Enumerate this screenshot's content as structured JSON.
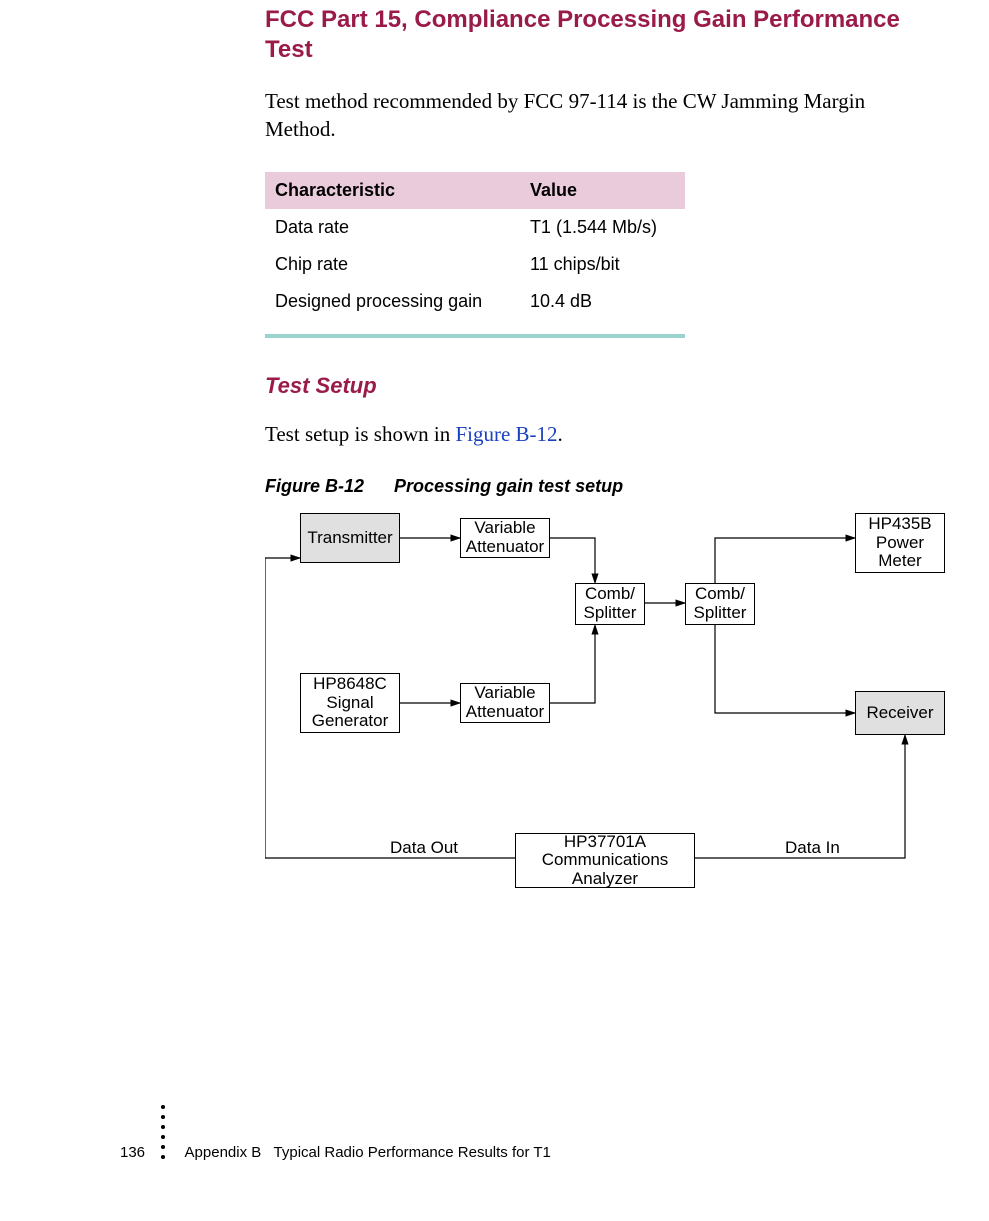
{
  "heading": "FCC Part 15, Compliance Processing Gain Performance Test",
  "intro": "Test method recommended by FCC 97-114 is the CW Jamming Margin Method.",
  "table": {
    "headers": {
      "c1": "Characteristic",
      "c2": "Value"
    },
    "rows": [
      {
        "c1": "Data rate",
        "c2": "T1 (1.544 Mb/s)"
      },
      {
        "c1": "Chip rate",
        "c2": "11 chips/bit"
      },
      {
        "c1": "Designed processing gain",
        "c2": "10.4 dB"
      }
    ]
  },
  "subheading": "Test Setup",
  "setup_text_pre": "Test setup is shown in ",
  "setup_link": "Figure B-12",
  "setup_text_post": ".",
  "figure_caption_num": "Figure B-12",
  "figure_caption_title": "Processing gain test setup",
  "diagram": {
    "transmitter": "Transmitter",
    "var_atten": "Variable\nAttenuator",
    "hp435b": "HP435B\nPower\nMeter",
    "comb_splitter": "Comb/\nSplitter",
    "hp8648c": "HP8648C\nSignal\nGenerator",
    "receiver": "Receiver",
    "hp37701a": "HP37701A\nCommunications\nAnalyzer",
    "data_out": "Data Out",
    "data_in": "Data In"
  },
  "footer": {
    "page": "136",
    "appendix_label": "Appendix B",
    "appendix_title": "Typical Radio Performance Results for T1"
  }
}
